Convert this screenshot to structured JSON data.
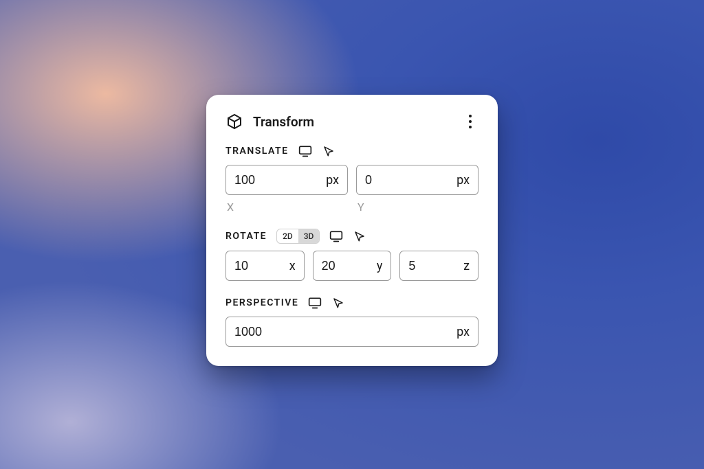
{
  "panel": {
    "title": "Transform"
  },
  "translate": {
    "title": "TRANSLATE",
    "x_value": "100",
    "x_unit": "px",
    "y_value": "0",
    "y_unit": "px",
    "x_label": "X",
    "y_label": "Y"
  },
  "rotate": {
    "title": "ROTATE",
    "toggle_2d": "2D",
    "toggle_3d": "3D",
    "x_value": "10",
    "x_unit": "x",
    "y_value": "20",
    "y_unit": "y",
    "z_value": "5",
    "z_unit": "z"
  },
  "perspective": {
    "title": "PERSPECTIVE",
    "value": "1000",
    "unit": "px"
  }
}
